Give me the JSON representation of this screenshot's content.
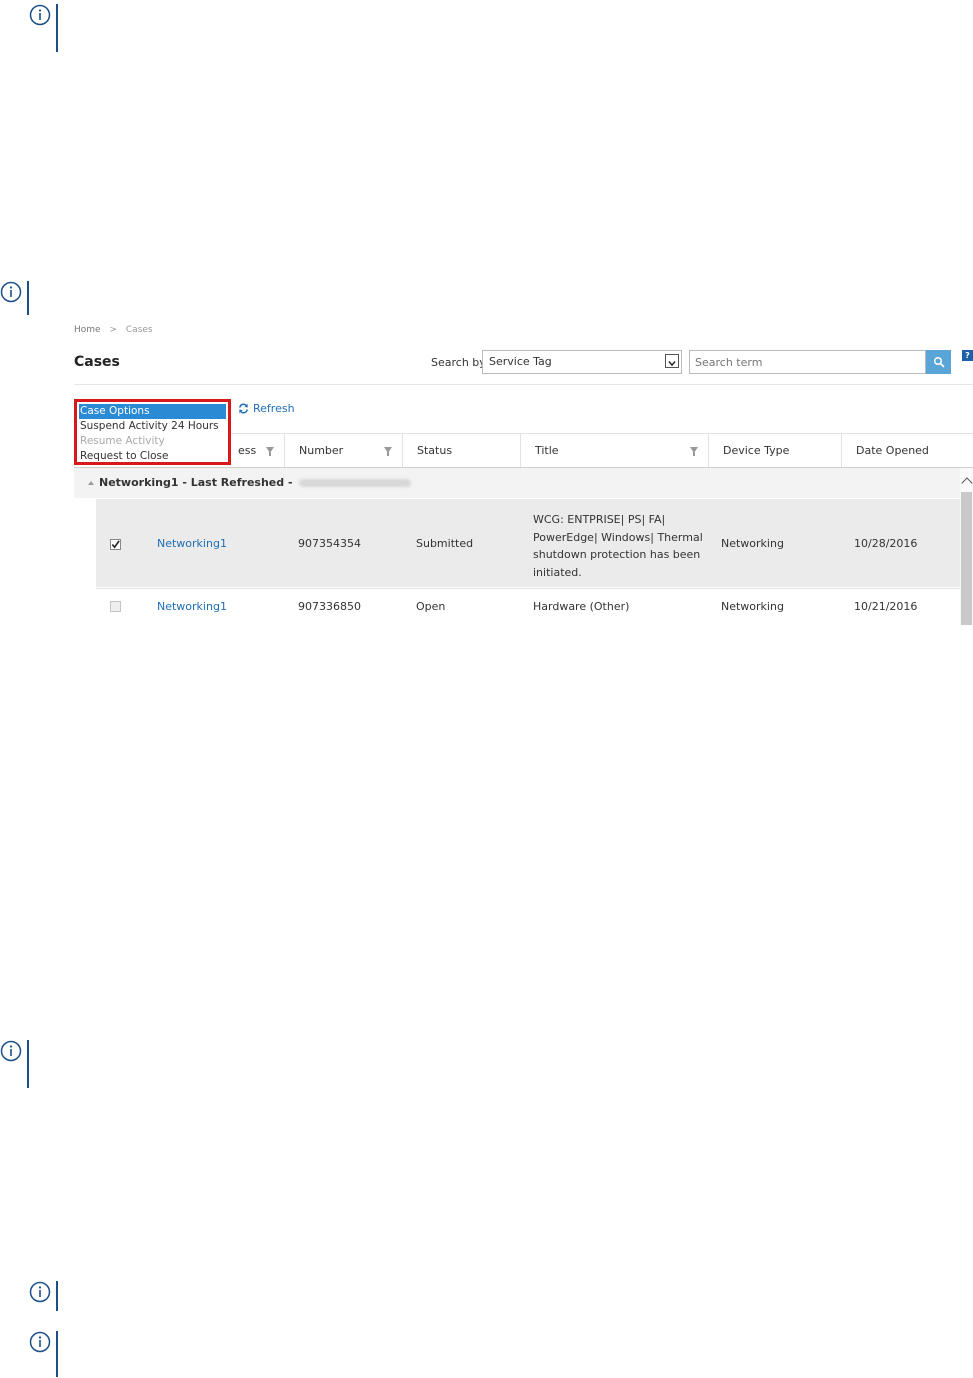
{
  "breadcrumb": {
    "home": "Home",
    "separator": ">",
    "current": "Cases"
  },
  "page_title": "Cases",
  "search": {
    "label": "Search by",
    "selected_option": "Service Tag",
    "placeholder": "Search term",
    "help_label": "?"
  },
  "toolbar": {
    "refresh_label": "Refresh"
  },
  "case_options_menu": {
    "items": [
      {
        "label": "Case Options",
        "state": "active"
      },
      {
        "label": "Suspend Activity 24 Hours",
        "state": "enabled"
      },
      {
        "label": "Resume Activity",
        "state": "disabled"
      },
      {
        "label": "Request to Close",
        "state": "enabled"
      }
    ]
  },
  "table": {
    "columns": [
      {
        "label": "ess",
        "filter": true
      },
      {
        "label": "Number",
        "filter": true
      },
      {
        "label": "Status",
        "filter": false
      },
      {
        "label": "Title",
        "filter": true
      },
      {
        "label": "Device Type",
        "filter": false
      },
      {
        "label": "Date Opened",
        "filter": false
      }
    ],
    "group": {
      "name": "Networking1 - Last Refreshed -",
      "redacted": true
    },
    "rows": [
      {
        "checked": true,
        "device": "Networking1",
        "number": "907354354",
        "status": "Submitted",
        "title_lines": [
          "WCG: ENTPRISE| PS| FA|",
          "PowerEdge| Windows| Thermal",
          "shutdown protection has been",
          "initiated."
        ],
        "device_type": "Networking",
        "date_opened": "10/28/2016"
      },
      {
        "checked": false,
        "device": "Networking1",
        "number": "907336850",
        "status": "Open",
        "title_lines": [
          "Hardware (Other)"
        ],
        "device_type": "Networking",
        "date_opened": "10/21/2016"
      }
    ]
  },
  "colors": {
    "accent": "#1d6eb5",
    "highlight_border": "#d7191c",
    "menu_active": "#2b8ad4",
    "note_icon": "#1a4f8a"
  },
  "icons": [
    "info-icon",
    "search-icon",
    "refresh-icon",
    "chevron-down-icon",
    "filter-icon",
    "checkmark-icon"
  ]
}
